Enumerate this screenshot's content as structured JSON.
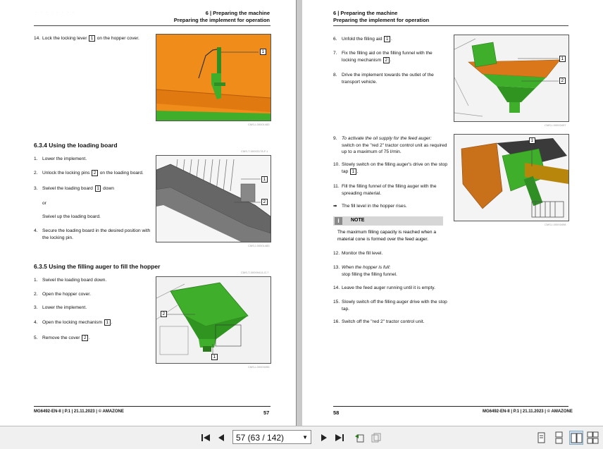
{
  "left_page": {
    "header_chapter": "6 | Preparing the machine",
    "header_section": "Preparing the implement for operation",
    "step14": {
      "num": "14.",
      "text_a": "Lock the locking lever",
      "callout": "1",
      "text_b": "on the hopper cover."
    },
    "img1_caption": "CMS-I-00001483",
    "section_634": "6.3.4  Using the loading board",
    "loading_steps": [
      {
        "num": "1.",
        "text_a": "Lower the implement.",
        "callout": "",
        "text_b": ""
      },
      {
        "num": "2.",
        "text_a": "Unlock the locking pins",
        "callout": "2",
        "text_b": "on the loading board."
      },
      {
        "num": "3.",
        "text_a": "Swivel the loading board",
        "callout": "1",
        "text_b": "down"
      },
      {
        "num": "",
        "text_a": "or",
        "callout": "",
        "text_b": ""
      },
      {
        "num": "",
        "text_a": "Swivel up the loading board.",
        "callout": "",
        "text_b": ""
      },
      {
        "num": "4.",
        "text_a": "Secure the loading board in the desired position with the locking pin.",
        "callout": "",
        "text_b": ""
      }
    ],
    "img2_ref": "CMS-T-00003178-F.1",
    "img2_caption": "CMS-I-00001483",
    "section_635": "6.3.5  Using the filling auger to fill the hopper",
    "auger_steps": [
      {
        "num": "1.",
        "text_a": "Swivel the loading board down.",
        "callout": "",
        "text_b": ""
      },
      {
        "num": "2.",
        "text_a": "Open the hopper cover.",
        "callout": "",
        "text_b": ""
      },
      {
        "num": "3.",
        "text_a": "Lower the implement.",
        "callout": "",
        "text_b": ""
      },
      {
        "num": "4.",
        "text_a": "Open the locking mechanism",
        "callout": "1",
        "text_b": "."
      },
      {
        "num": "5.",
        "text_a": "Remove the cover",
        "callout": "2",
        "text_b": "."
      }
    ],
    "img3_ref": "CMS-T-00009414-G.7",
    "img3_caption": "CMS-I-00003496",
    "footer_left": "MG6492-EN-II | P.1 | 21.11.2023 | © AMAZONE",
    "page_number": "57"
  },
  "right_page": {
    "header_chapter": "6 | Preparing the machine",
    "header_section": "Preparing the implement for operation",
    "steps_a": [
      {
        "num": "6.",
        "text_a": "Unfold the filling aid",
        "callout": "1",
        "text_b": "."
      },
      {
        "num": "7.",
        "text_a": "Fix the filling aid on the filling funnel with the locking mechanism",
        "callout": "2",
        "text_b": "."
      },
      {
        "num": "8.",
        "text_a": "Drive the implement towards the outlet of the transport vehicle.",
        "callout": "",
        "text_b": ""
      }
    ],
    "img4_caption": "CMS-I-00003497",
    "step9": {
      "num": "9.",
      "italic": "To activate the oil supply for the feed auger:",
      "text": "switch on the \"red 2\" tractor control unit as required up to a maximum of 75 l/min."
    },
    "step10": {
      "num": "10.",
      "text_a": "Slowly switch on the filling auger's drive on the stop tap",
      "callout": "1",
      "text_b": "."
    },
    "step11": {
      "num": "11.",
      "text": "Fill the filling funnel of the filling auger with the spreading material."
    },
    "result": {
      "arrow": "➡",
      "text": "The fill level in the hopper rises."
    },
    "note": {
      "label": "NOTE",
      "text": "The maximum filling capacity is reached when a material cone is formed over the feed auger."
    },
    "step12": {
      "num": "12.",
      "text": "Monitor the fill level."
    },
    "step13": {
      "num": "13.",
      "italic": "When the hopper is full:",
      "text": "stop filling the filling funnel."
    },
    "step14": {
      "num": "14.",
      "text": "Leave the feed auger running until it is empty."
    },
    "step15": {
      "num": "15.",
      "text": "Slowly switch off the filling auger drive with the stop tap."
    },
    "step16": {
      "num": "16.",
      "text": "Switch off the \"red 2\" tractor control unit."
    },
    "img5_caption": "CMS-I-00003498",
    "page_number": "58",
    "footer_right": "MG6492-EN-II | P.1 | 21.11.2023 | © AMAZONE"
  },
  "callouts": {
    "one": "1",
    "two": "2"
  },
  "toolbar": {
    "page_indicator": "57 (63 / 142)",
    "icons": [
      "first-page-icon",
      "previous-page-icon",
      "next-page-icon",
      "last-page-icon",
      "go-back-icon",
      "go-forward-icon",
      "single-page-view-icon",
      "continuous-view-icon",
      "two-page-view-icon",
      "two-page-continuous-view-icon"
    ]
  },
  "colors": {
    "amazone_green": "#3fae2a",
    "amazone_orange": "#f0901e",
    "note_grey": "#d6d6d6"
  }
}
